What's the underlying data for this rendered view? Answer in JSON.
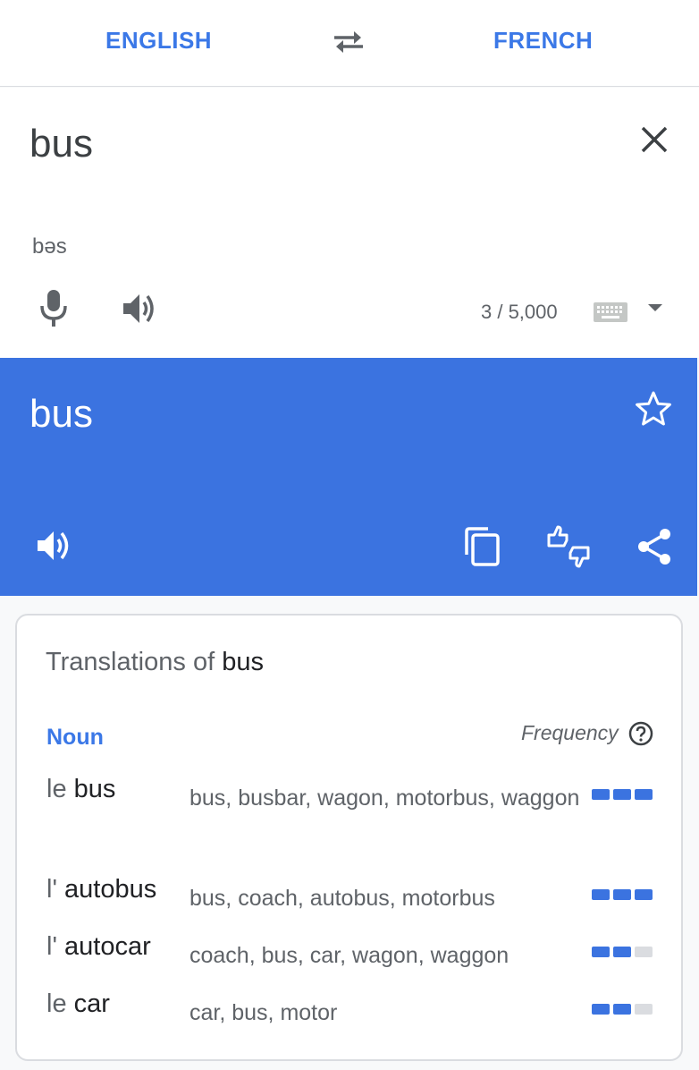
{
  "languages": {
    "source": "ENGLISH",
    "target": "FRENCH"
  },
  "icons": {
    "swap": "swap-arrows-icon",
    "clear": "close-icon",
    "mic": "mic-icon",
    "speaker": "speaker-icon",
    "keyboard": "keyboard-icon",
    "dropdown": "caret-down-icon",
    "star": "star-outline-icon",
    "copy": "copy-icon",
    "feedback": "thumbs-feedback-icon",
    "share": "share-icon",
    "help": "help-circle-icon"
  },
  "input": {
    "text": "bus",
    "phonetic": "bəs",
    "char_count": "3 / 5,000"
  },
  "output": {
    "text": "bus"
  },
  "colors": {
    "accent": "#3b78e7",
    "output_bg": "#3b73e0",
    "frequency_on": "#3b73e0",
    "frequency_off": "#dadce0"
  },
  "translations": {
    "title_prefix": "Translations of ",
    "query": "bus",
    "part_of_speech": "Noun",
    "frequency_label": "Frequency",
    "entries": [
      {
        "article": "le ",
        "word": "bus",
        "synonyms": "bus, busbar, wagon, motorbus, waggon",
        "frequency": 3
      },
      {
        "article": "l' ",
        "word": "autobus",
        "synonyms": "bus, coach, autobus, motorbus",
        "frequency": 3
      },
      {
        "article": "l' ",
        "word": "autocar",
        "synonyms": "coach, bus, car, wagon, waggon",
        "frequency": 2
      },
      {
        "article": "le ",
        "word": "car",
        "synonyms": "car, bus, motor",
        "frequency": 2
      }
    ]
  }
}
